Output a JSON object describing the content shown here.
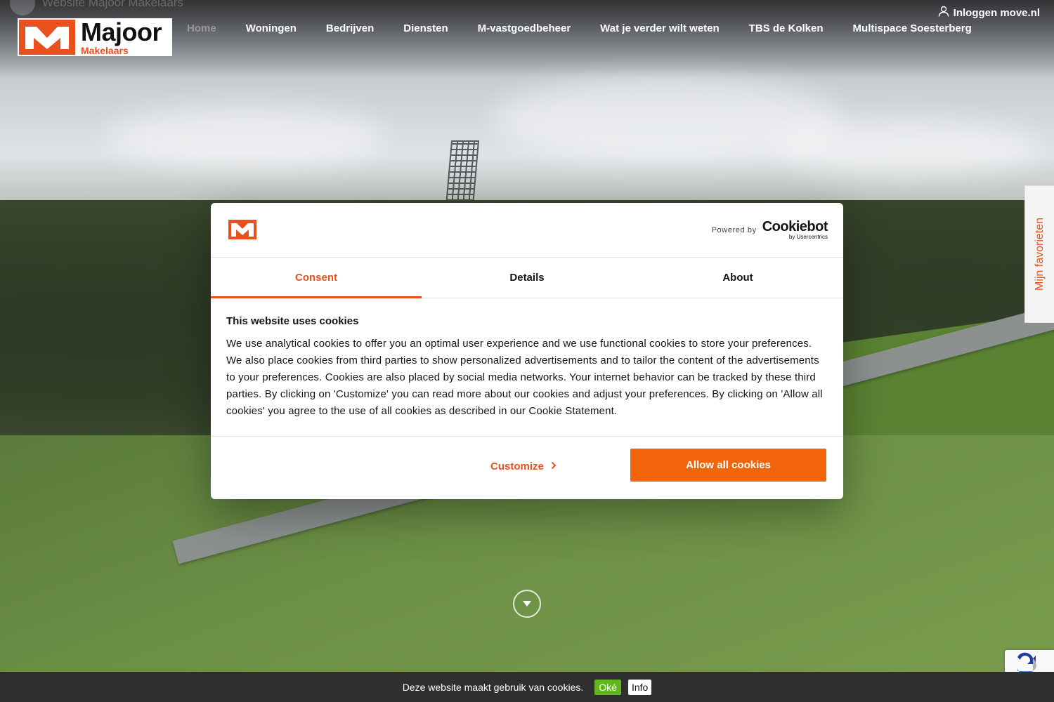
{
  "header": {
    "ghost_title": "Website Majoor Makelaars",
    "logo_text": "Majoor",
    "logo_subtext": "Makelaars",
    "login_label": "Inloggen move.nl"
  },
  "nav": {
    "items": [
      {
        "label": "Home",
        "active": true
      },
      {
        "label": "Woningen"
      },
      {
        "label": "Bedrijven"
      },
      {
        "label": "Diensten"
      },
      {
        "label": "M-vastgoedbeheer"
      },
      {
        "label": "Wat je verder wilt weten"
      },
      {
        "label": "TBS de Kolken"
      },
      {
        "label": "Multispace Soesterberg"
      }
    ]
  },
  "side_tab": {
    "label": "Mijn favorieten"
  },
  "cookie_dialog": {
    "powered_by": "Powered by",
    "provider": "Cookiebot",
    "provider_sub": "by Usercentrics",
    "tabs": [
      {
        "label": "Consent",
        "active": true
      },
      {
        "label": "Details"
      },
      {
        "label": "About"
      }
    ],
    "heading": "This website uses cookies",
    "body": "We use analytical cookies to offer you an optimal user experience and we use functional cookies to store your preferences. We also place cookies from third parties to show personalized advertisements and to tailor the content of the advertisements to your preferences. Cookies are also placed by social media networks. Your internet behavior can be tracked by these third parties. By clicking on 'Customize' you can read more about our cookies and adjust your preferences. By clicking on 'Allow all cookies' you agree to the use of all cookies as described in our Cookie Statement.",
    "customize_label": "Customize",
    "allow_label": "Allow all cookies"
  },
  "cookie_bar": {
    "message": "Deze website maakt gebruik van cookies.",
    "ok_label": "Oké",
    "info_label": "Info"
  },
  "icons": {
    "user": "user-icon",
    "chevron_right": "chevron-right-icon",
    "scroll_down": "chevron-down-icon"
  },
  "colors": {
    "brand_orange": "#e8501c",
    "button_orange": "#f2640a",
    "ok_green": "#62b51d",
    "cookiebar_bg": "#2f2f2f"
  }
}
